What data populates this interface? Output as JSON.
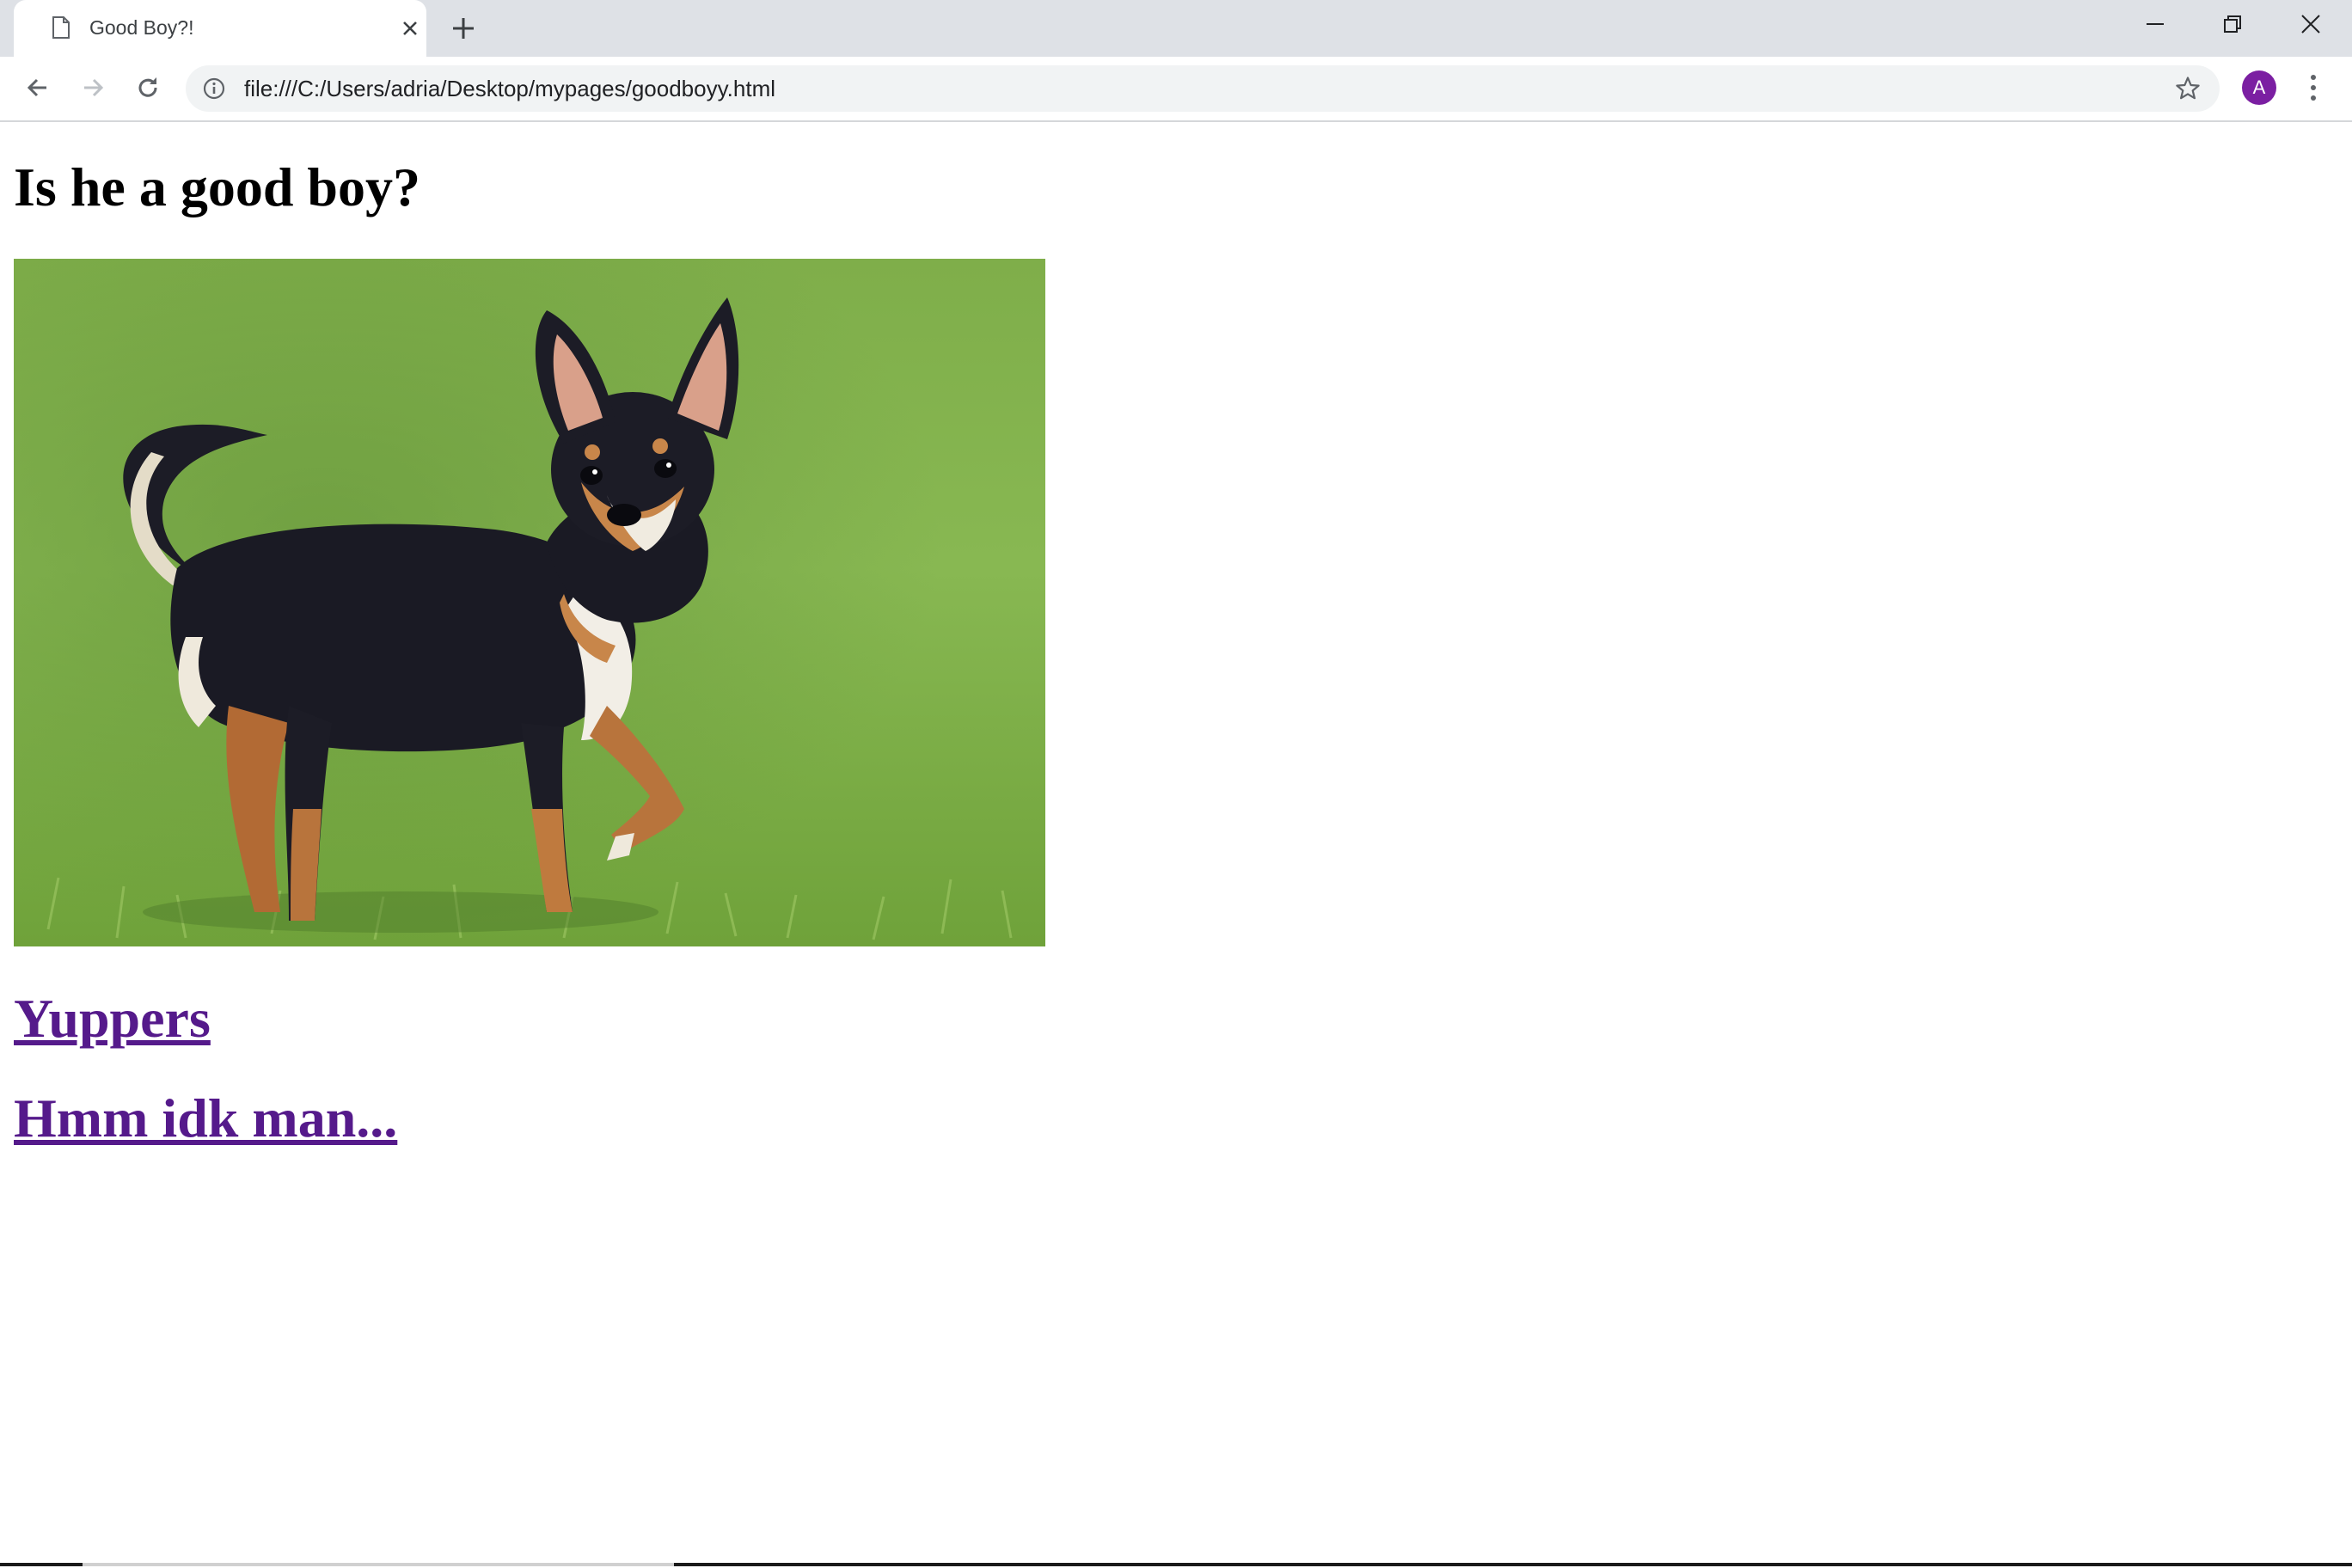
{
  "browser": {
    "tab": {
      "title": "Good Boy?!"
    },
    "address": {
      "url": "file:///C:/Users/adria/Desktop/mypages/goodboyy.html"
    },
    "profile": {
      "initial": "A",
      "color": "#7b1fa2"
    }
  },
  "page": {
    "title": "Is he a good boy?",
    "image": {
      "subject": "black and tan chihuahua standing on grass"
    },
    "links": [
      {
        "label": "Yuppers",
        "color": "#551a8b"
      },
      {
        "label": "Hmm idk man...",
        "color": "#551a8b"
      }
    ]
  },
  "colors": {
    "tabstrip": "#dee1e6",
    "omnibox": "#f1f3f4",
    "visited_link": "#551a8b"
  },
  "icons": [
    "page-icon",
    "close-icon",
    "plus-icon",
    "minimize-icon",
    "restore-icon",
    "window-close-icon",
    "back-arrow-icon",
    "forward-arrow-icon",
    "reload-icon",
    "info-icon",
    "star-icon",
    "kebab-menu-icon"
  ]
}
